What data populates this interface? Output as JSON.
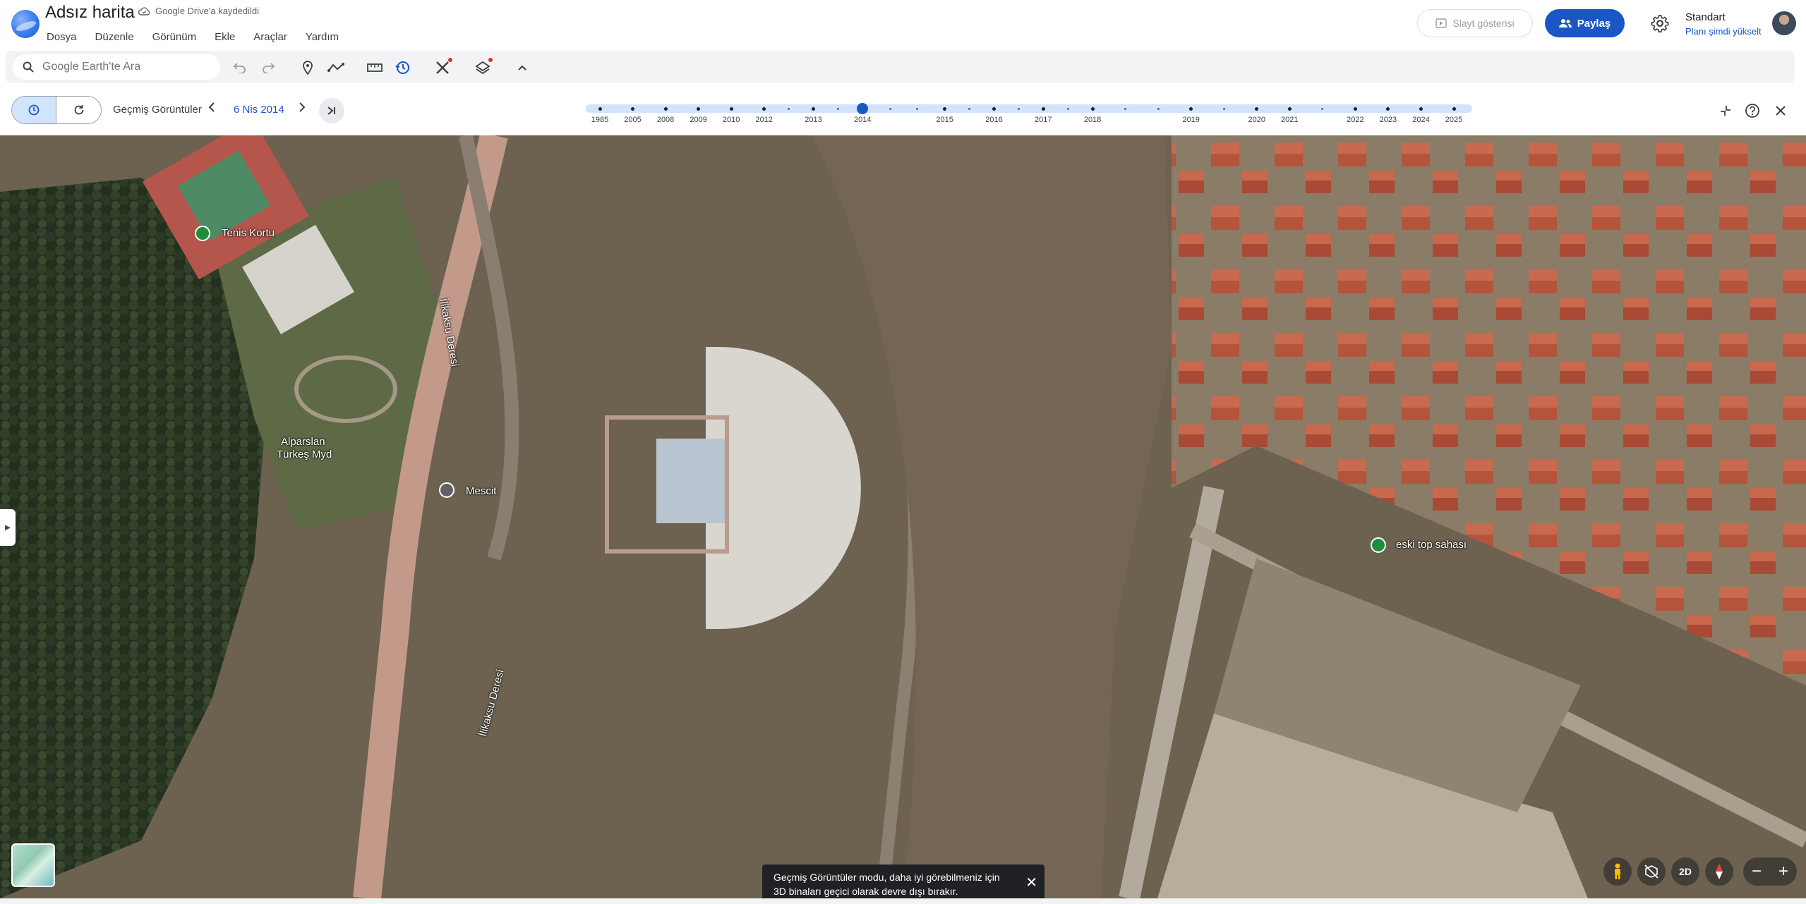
{
  "app": {
    "title": "Adsız harita",
    "saved_status": "Google Drive'a kaydedildi",
    "menu": [
      "Dosya",
      "Düzenle",
      "Görünüm",
      "Ekle",
      "Araçlar",
      "Yardım"
    ],
    "slideshow_label": "Slayt gösterisi",
    "share_label": "Paylaş",
    "plan_name": "Standart",
    "plan_upgrade": "Planı şimdi yükselt"
  },
  "search": {
    "placeholder": "Google Earth'te Ara"
  },
  "history": {
    "label": "Geçmiş Görüntüler",
    "current_date": "6 Nis 2014",
    "years": [
      "1985",
      "2005",
      "2008",
      "2009",
      "2010",
      "2012",
      "2013",
      "2014",
      "2015",
      "2016",
      "2017",
      "2018",
      "2019",
      "2020",
      "2021",
      "2022",
      "2023",
      "2024",
      "2025"
    ],
    "selected_year": "2014"
  },
  "map": {
    "labels": {
      "tenis": "Tenis Kortu",
      "deresi_top": "İlikaksu Deresi",
      "deresi_bottom": "İlikaksu Deresi",
      "park_line1": "Alparslan",
      "park_line2": "Türkeş Myd",
      "mescit": "Mescit",
      "eski": "eski top sahası"
    }
  },
  "toast": {
    "text_line1": "Geçmiş Görüntüler modu, daha iyi görebilmeniz için",
    "text_line2": "3D binaları geçici olarak devre dışı bırakır."
  },
  "controls": {
    "mode_2d": "2D"
  },
  "colors": {
    "accent": "#1a56c4",
    "pin_green": "#1e8e3e",
    "pin_gray": "#5f6368"
  }
}
